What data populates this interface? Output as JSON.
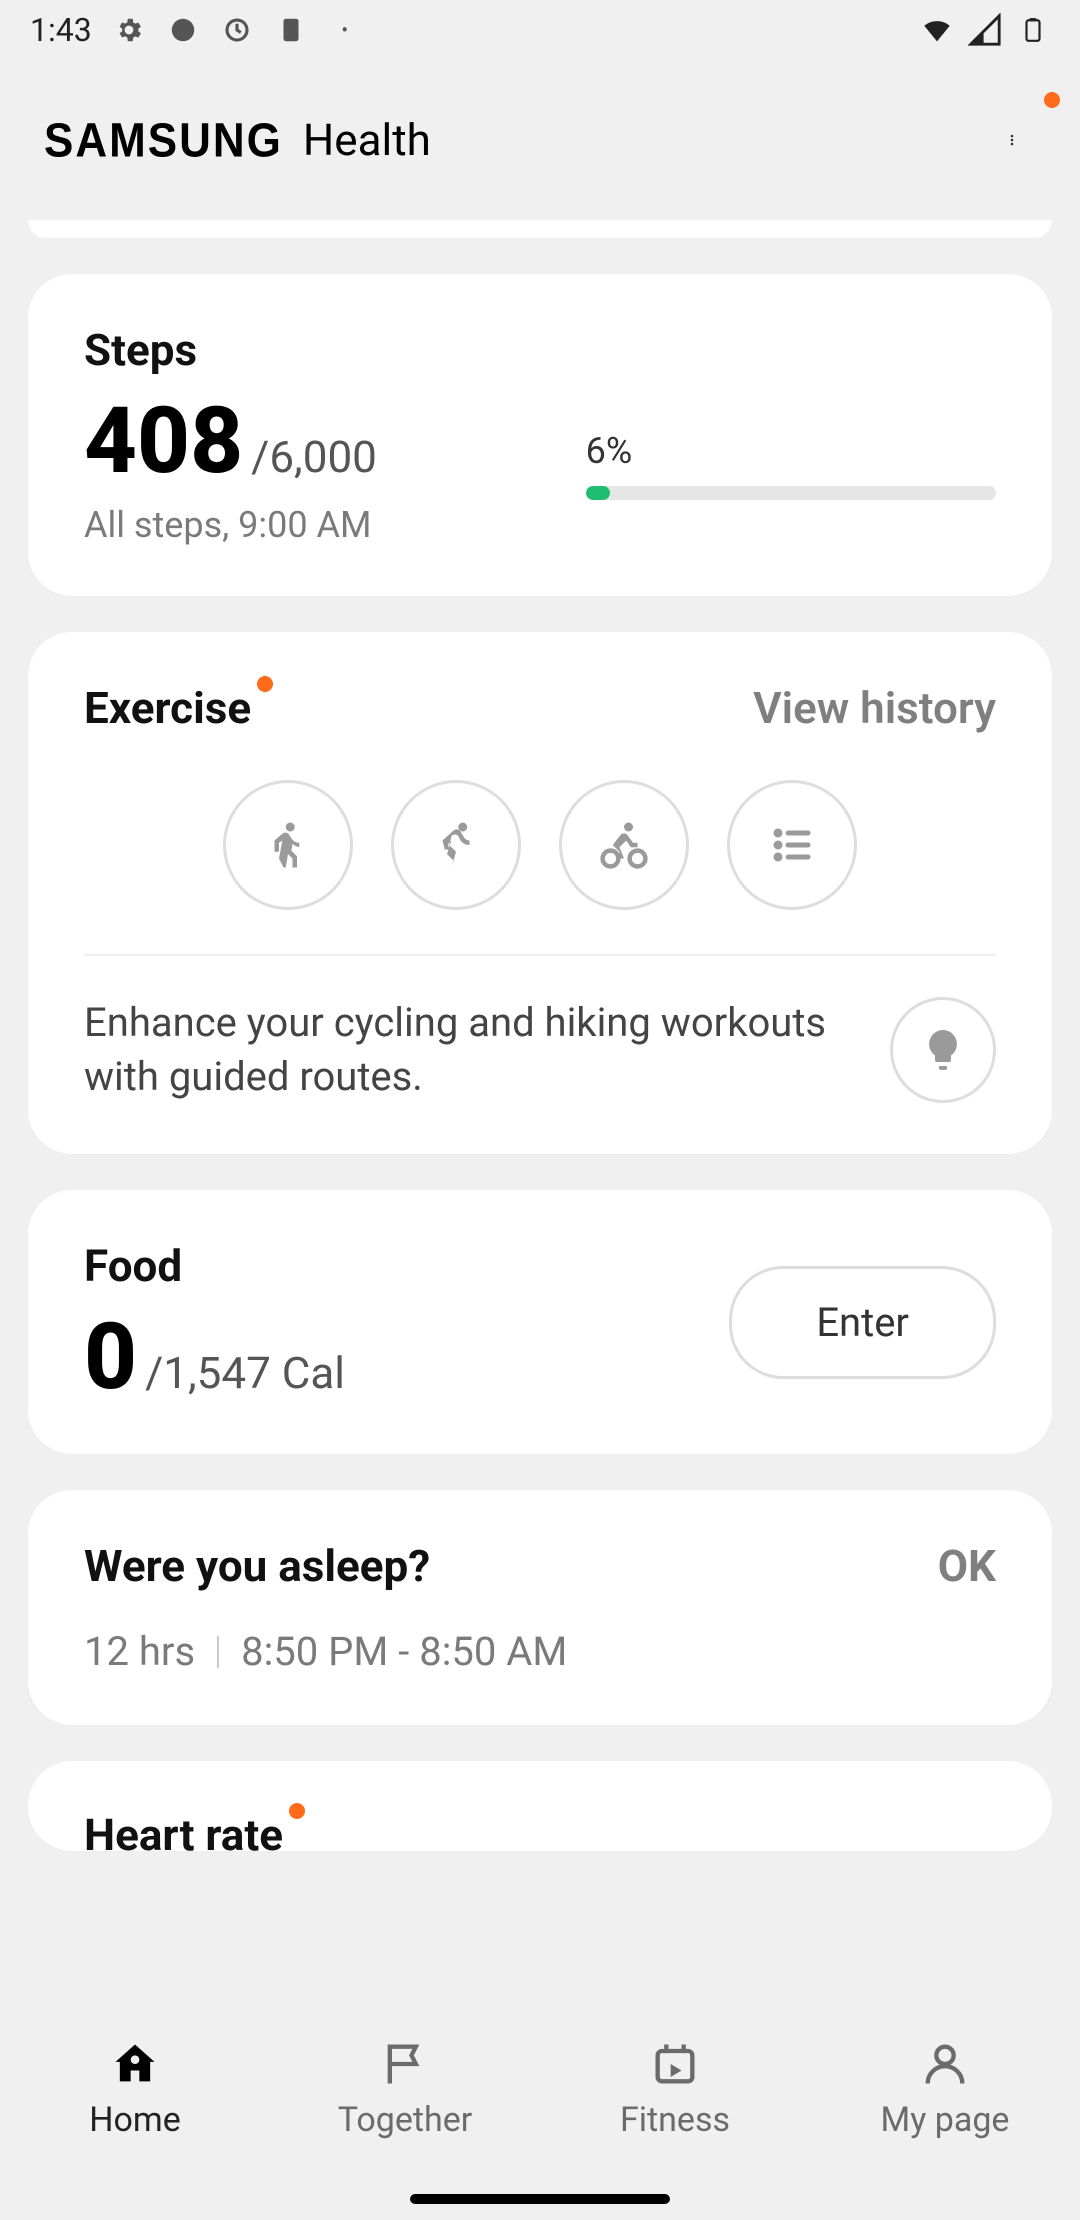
{
  "status": {
    "time": "1:43"
  },
  "header": {
    "brand": "SAMSUNG",
    "app": "Health"
  },
  "steps": {
    "title": "Steps",
    "value": "408",
    "goal_prefix": "/",
    "goal": "6,000",
    "sub": "All steps, 9:00 AM",
    "pct_label": "6%",
    "pct_value": 6
  },
  "exercise": {
    "title": "Exercise",
    "view_history": "View history",
    "tip": "Enhance your cycling and hiking workouts with guided routes."
  },
  "food": {
    "title": "Food",
    "value": "0",
    "goal_prefix": "/",
    "goal": "1,547 Cal",
    "enter": "Enter"
  },
  "sleep": {
    "title": "Were you asleep?",
    "ok": "OK",
    "duration": "12 hrs",
    "range": "8:50 PM - 8:50 AM"
  },
  "heart": {
    "title": "Heart rate"
  },
  "nav": {
    "home": "Home",
    "together": "Together",
    "fitness": "Fitness",
    "mypage": "My page"
  }
}
